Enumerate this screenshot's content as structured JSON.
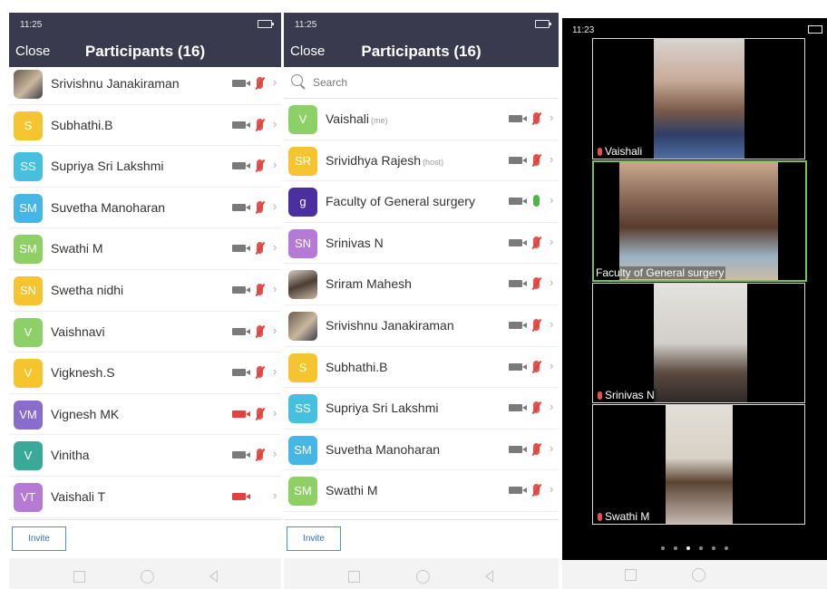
{
  "left_panel": {
    "status_time": "11:25",
    "nav": {
      "close": "Close",
      "title": "Participants (16)"
    },
    "rows": [
      {
        "name": "Srivishnu Janakiraman",
        "initials": "",
        "avatar": "photo",
        "color": "#6b5a4c",
        "video": "off-grey",
        "mic": "muted"
      },
      {
        "name": "Subhathi.B",
        "initials": "S",
        "color": "#f5c531",
        "video": "off-grey",
        "mic": "muted"
      },
      {
        "name": "Supriya Sri Lakshmi",
        "initials": "SS",
        "color": "#47c0e0",
        "video": "off-grey",
        "mic": "muted"
      },
      {
        "name": "Suvetha Manoharan",
        "initials": "SM",
        "color": "#47b6e6",
        "video": "off-grey",
        "mic": "muted"
      },
      {
        "name": "Swathi M",
        "initials": "SM",
        "color": "#8fd066",
        "video": "off-grey",
        "mic": "muted"
      },
      {
        "name": "Swetha nidhi",
        "initials": "SN",
        "color": "#f6c431",
        "video": "off-grey",
        "mic": "muted"
      },
      {
        "name": "Vaishnavi",
        "initials": "V",
        "color": "#8ed068",
        "video": "off-grey",
        "mic": "muted"
      },
      {
        "name": "Vigknesh.S",
        "initials": "V",
        "color": "#f6c42c",
        "video": "off-grey",
        "mic": "muted"
      },
      {
        "name": "Vignesh MK",
        "initials": "VM",
        "color": "#8a6ccf",
        "video": "off-red",
        "mic": "muted"
      },
      {
        "name": "Vinitha",
        "initials": "V",
        "color": "#3aa999",
        "video": "off-grey",
        "mic": "muted"
      },
      {
        "name": "Vaishali T",
        "initials": "VT",
        "color": "#b57ad6",
        "video": "off-red",
        "mic": "none"
      }
    ],
    "invite": "Invite"
  },
  "middle_panel": {
    "status_time": "11:25",
    "nav": {
      "close": "Close",
      "title": "Participants (16)"
    },
    "search_placeholder": "Search",
    "rows": [
      {
        "name": "Vaishali",
        "tag": "(me)",
        "initials": "V",
        "color": "#8ed068",
        "video": "off-grey",
        "mic": "muted"
      },
      {
        "name": "Srividhya Rajesh",
        "tag": "(host)",
        "initials": "SR",
        "color": "#f6c431",
        "video": "off-grey",
        "mic": "muted"
      },
      {
        "name": "Faculty of General surgery",
        "initials": "g",
        "color": "#4b2fa0",
        "video": "off-grey",
        "mic": "on"
      },
      {
        "name": "Srinivas N",
        "initials": "SN",
        "color": "#b57ad6",
        "video": "off-grey",
        "mic": "muted"
      },
      {
        "name": "Sriram Mahesh",
        "initials": "",
        "avatar": "photo2",
        "color": "#4a3c32",
        "video": "off-grey",
        "mic": "muted"
      },
      {
        "name": "Srivishnu Janakiraman",
        "initials": "",
        "avatar": "photo",
        "color": "#6b5a4c",
        "video": "off-grey",
        "mic": "muted"
      },
      {
        "name": "Subhathi.B",
        "initials": "S",
        "color": "#f6c431",
        "video": "off-grey",
        "mic": "muted"
      },
      {
        "name": "Supriya Sri Lakshmi",
        "initials": "SS",
        "color": "#47c0e0",
        "video": "off-grey",
        "mic": "muted"
      },
      {
        "name": "Suvetha Manoharan",
        "initials": "SM",
        "color": "#47b6e6",
        "video": "off-grey",
        "mic": "muted"
      },
      {
        "name": "Swathi M",
        "initials": "SM",
        "color": "#8fd066",
        "video": "off-grey",
        "mic": "muted"
      }
    ],
    "invite": "Invite"
  },
  "right_panel": {
    "status_time": "11:23",
    "tiles": [
      {
        "label": "Vaishali",
        "muted": true,
        "active": false
      },
      {
        "label": "Faculty of General surgery",
        "muted": false,
        "active": true
      },
      {
        "label": "Srinivas N",
        "muted": true,
        "active": false
      },
      {
        "label": "Swathi M",
        "muted": true,
        "active": false
      }
    ],
    "page_count": 6,
    "current_page": 3
  },
  "colors": {
    "nav_bg": "#3a3a4e",
    "mic_muted": "#e65050",
    "mic_on": "#52b34a",
    "video_off_red": "#e34040",
    "active_border": "#7cc24a",
    "invite_blue": "#2f70c0"
  }
}
